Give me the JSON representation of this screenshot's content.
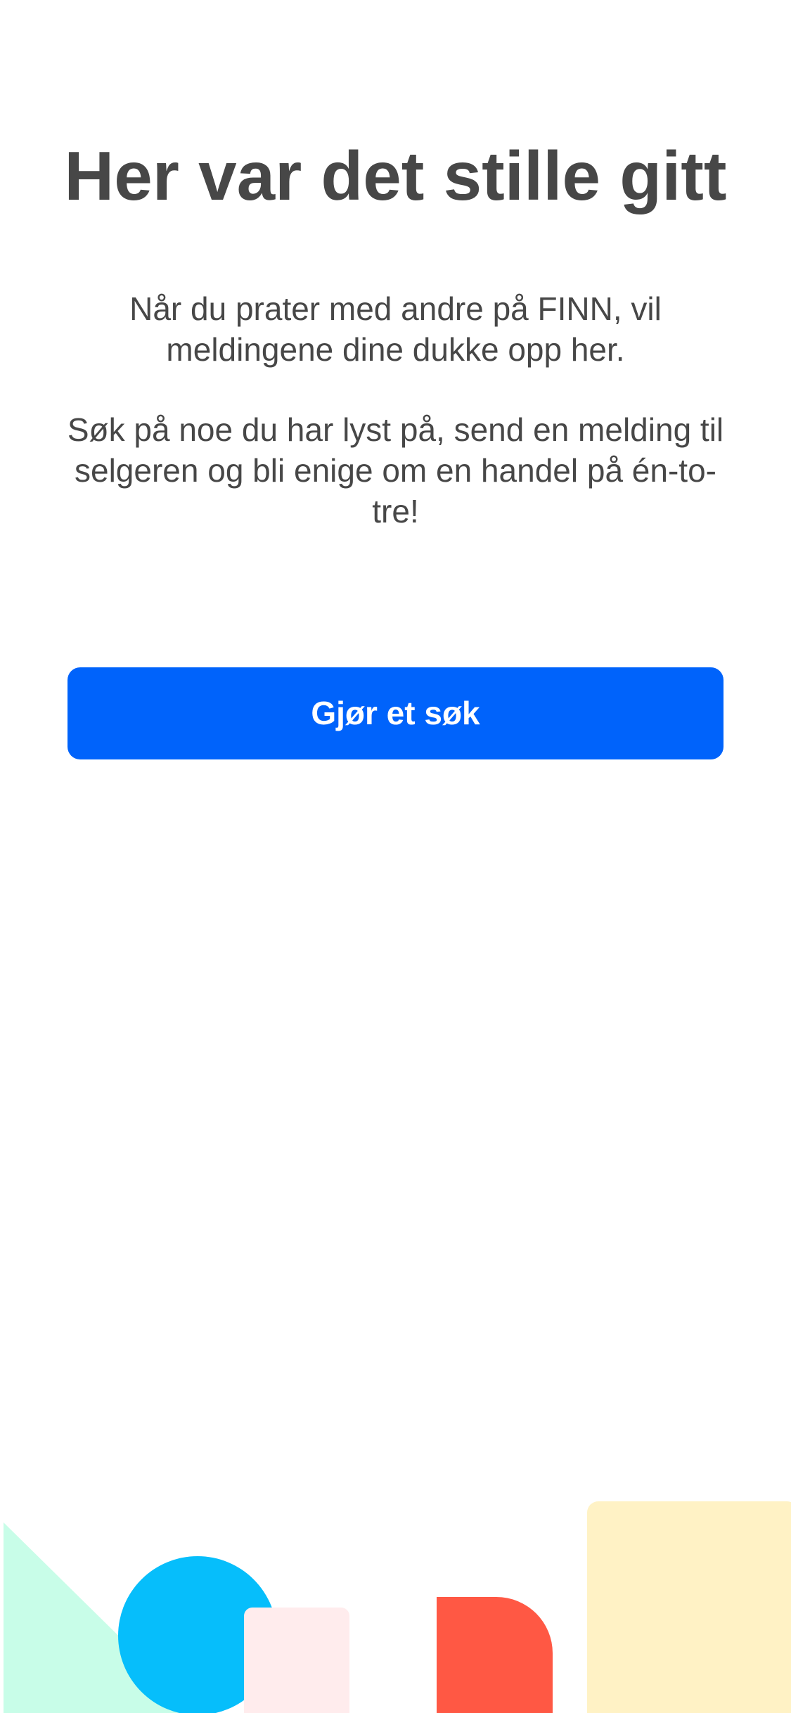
{
  "empty_state": {
    "title": "Her var det stille gitt",
    "paragraph_1": "Når du prater med andre på FINN, vil meldingene dine dukke opp her.",
    "paragraph_2": "Søk på noe du har lyst på, send en melding til selgeren og bli enige om en handel på én-to-tre!",
    "button_label": "Gjør et søk"
  },
  "colors": {
    "text": "#474747",
    "primary_button": "#0063fb",
    "shape_mint": "#c8fde8",
    "shape_blue": "#06befb",
    "shape_pink": "#ffeced",
    "shape_red": "#ff5844",
    "shape_yellow": "#fff2c5"
  }
}
